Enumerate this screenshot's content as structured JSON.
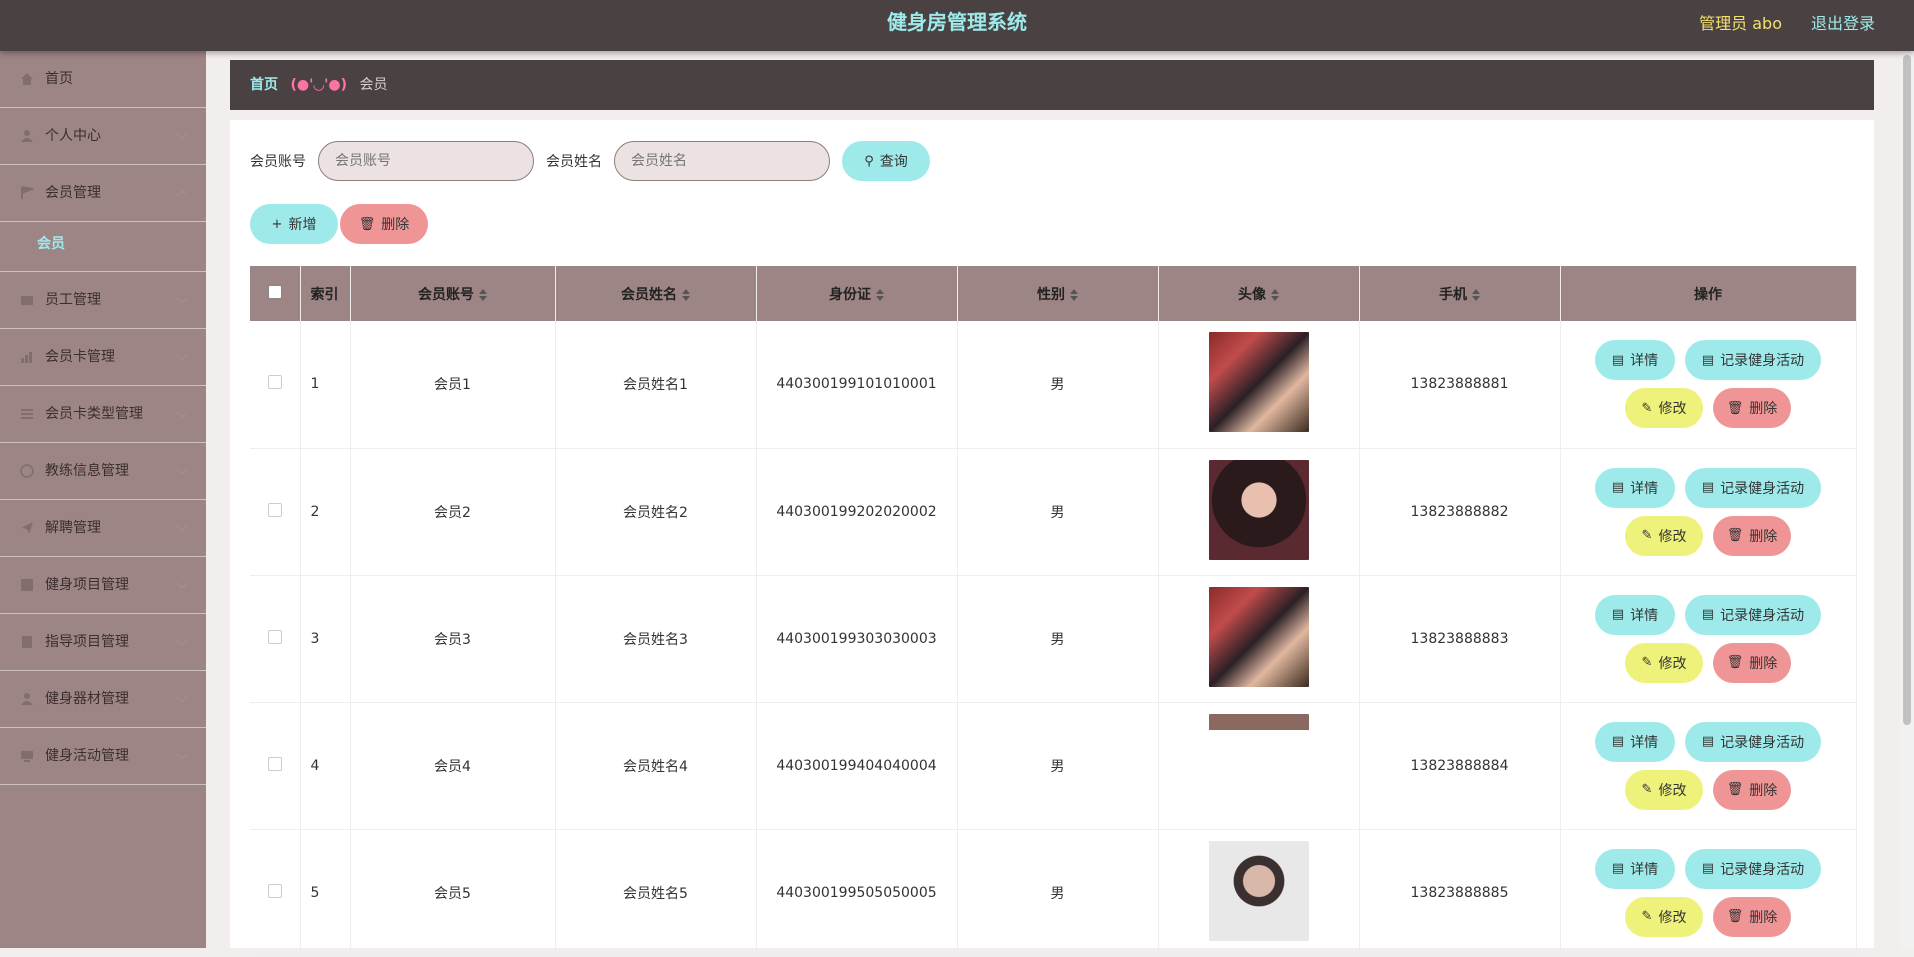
{
  "header": {
    "title": "健身房管理系统",
    "user": "管理员 abo",
    "logout": "退出登录"
  },
  "sidebar": {
    "items": [
      {
        "label": "首页"
      },
      {
        "label": "个人中心"
      },
      {
        "label": "会员管理"
      },
      {
        "label": "员工管理"
      },
      {
        "label": "会员卡管理"
      },
      {
        "label": "会员卡类型管理"
      },
      {
        "label": "教练信息管理"
      },
      {
        "label": "解聘管理"
      },
      {
        "label": "健身项目管理"
      },
      {
        "label": "指导项目管理"
      },
      {
        "label": "健身器材管理"
      },
      {
        "label": "健身活动管理"
      }
    ],
    "sub_active": "会员"
  },
  "breadcrumb": {
    "home": "首页",
    "sep": "(●'◡'●)",
    "current": "会员"
  },
  "search": {
    "account_label": "会员账号",
    "account_placeholder": "会员账号",
    "name_label": "会员姓名",
    "name_placeholder": "会员姓名",
    "query_button": "查询"
  },
  "actions": {
    "add": "新增",
    "delete": "删除"
  },
  "table": {
    "columns": [
      "索引",
      "会员账号",
      "会员姓名",
      "身份证",
      "性别",
      "头像",
      "手机",
      "操作"
    ],
    "rows": [
      {
        "index": "1",
        "account": "会员1",
        "name": "会员姓名1",
        "id_card": "440300199101010001",
        "gender": "男",
        "phone": "13823888881"
      },
      {
        "index": "2",
        "account": "会员2",
        "name": "会员姓名2",
        "id_card": "440300199202020002",
        "gender": "男",
        "phone": "13823888882"
      },
      {
        "index": "3",
        "account": "会员3",
        "name": "会员姓名3",
        "id_card": "440300199303030003",
        "gender": "男",
        "phone": "13823888883"
      },
      {
        "index": "4",
        "account": "会员4",
        "name": "会员姓名4",
        "id_card": "440300199404040004",
        "gender": "男",
        "phone": "13823888884"
      },
      {
        "index": "5",
        "account": "会员5",
        "name": "会员姓名5",
        "id_card": "440300199505050005",
        "gender": "男",
        "phone": "13823888885"
      }
    ],
    "row_actions": {
      "detail": "详情",
      "record": "记录健身活动",
      "edit": "修改",
      "delete": "删除"
    }
  }
}
